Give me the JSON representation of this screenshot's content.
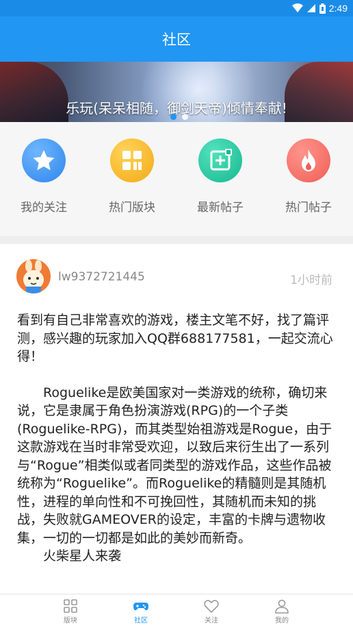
{
  "status_bar": {
    "time": "2:49"
  },
  "app_bar": {
    "title": "社区"
  },
  "banner": {
    "caption": "乐玩(呆呆相随，御剑天帝)倾情奉献!"
  },
  "quick_menu": [
    {
      "label": "我的关注",
      "icon": "star-icon",
      "color": "#3b8ff0"
    },
    {
      "label": "热门版块",
      "icon": "grid-icon",
      "color": "#f6b51e"
    },
    {
      "label": "最新帖子",
      "icon": "new-post-icon",
      "color": "#20c2a0"
    },
    {
      "label": "热门帖子",
      "icon": "fire-icon",
      "color": "#f26b63"
    }
  ],
  "post": {
    "username": "lw9372721445",
    "time": "1小时前",
    "paragraphs": [
      "看到有自己非常喜欢的游戏，楼主文笔不好，找了篇评测，感兴趣的玩家加入QQ群688177581，一起交流心得！",
      "Roguelike是欧美国家对一类游戏的统称，确切来说，它是隶属于角色扮演游戏(RPG)的一个子类(Roguelike-RPG)，而其类型始祖游戏是Rogue，由于这款游戏在当时非常受欢迎，以致后来衍生出了一系列与“Rogue”相类似或者同类型的游戏作品，这些作品被统称为“Roguelike”。而Roguelike的精髓则是其随机性，进程的单向性和不可挽回性，其随机而未知的挑战，失败就GAMEOVER的设定，丰富的卡牌与遗物收集，一切的一切都是如此的美妙而新奇。",
      "火柴星人来袭"
    ]
  },
  "bottom_nav": [
    {
      "label": "版块",
      "icon": "blocks-icon"
    },
    {
      "label": "社区",
      "icon": "gamepad-icon"
    },
    {
      "label": "关注",
      "icon": "heart-icon"
    },
    {
      "label": "我的",
      "icon": "person-icon"
    }
  ],
  "colors": {
    "primary": "#2196f3",
    "status_bar": "#1a8ce8"
  }
}
